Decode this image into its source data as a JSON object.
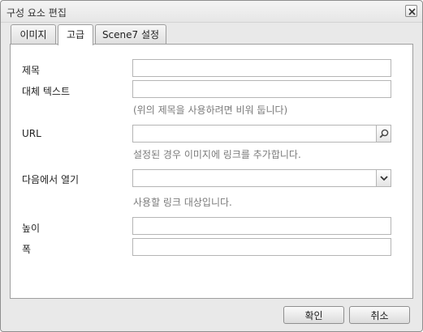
{
  "dialog": {
    "title": "구성 요소 편집",
    "close_icon": "close-icon"
  },
  "tabs": [
    {
      "label": "이미지",
      "active": false
    },
    {
      "label": "고급",
      "active": true
    },
    {
      "label": "Scene7 설정",
      "active": false
    }
  ],
  "form": {
    "title": {
      "label": "제목",
      "value": ""
    },
    "alt_text": {
      "label": "대체 텍스트",
      "value": "",
      "hint": "(위의 제목을 사용하려면 비워 둡니다)"
    },
    "url": {
      "label": "URL",
      "value": "",
      "hint": "설정된 경우 이미지에 링크를 추가합니다.",
      "trigger_icon": "search-icon"
    },
    "open_in": {
      "label": "다음에서 열기",
      "value": "",
      "hint": "사용할 링크 대상입니다.",
      "trigger_icon": "chevron-down-icon"
    },
    "height": {
      "label": "높이",
      "value": ""
    },
    "width": {
      "label": "폭",
      "value": ""
    }
  },
  "footer": {
    "ok_label": "확인",
    "cancel_label": "취소"
  }
}
